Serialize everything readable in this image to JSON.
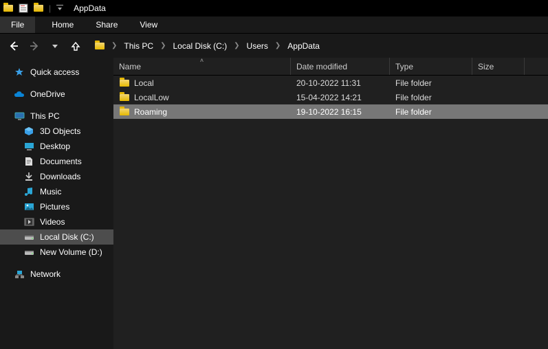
{
  "title": "AppData",
  "tabs": {
    "file": "File",
    "home": "Home",
    "share": "Share",
    "view": "View"
  },
  "breadcrumb": [
    "This PC",
    "Local Disk (C:)",
    "Users",
    "AppData"
  ],
  "sidebar": {
    "quick": "Quick access",
    "onedrive": "OneDrive",
    "thispc": "This PC",
    "children": [
      "3D Objects",
      "Desktop",
      "Documents",
      "Downloads",
      "Music",
      "Pictures",
      "Videos",
      "Local Disk (C:)",
      "New Volume (D:)"
    ],
    "network": "Network"
  },
  "columns": {
    "name": "Name",
    "date": "Date modified",
    "type": "Type",
    "size": "Size"
  },
  "rows": [
    {
      "name": "Local",
      "date": "20-10-2022 11:31",
      "type": "File folder",
      "selected": false
    },
    {
      "name": "LocalLow",
      "date": "15-04-2022 14:21",
      "type": "File folder",
      "selected": false
    },
    {
      "name": "Roaming",
      "date": "19-10-2022 16:15",
      "type": "File folder",
      "selected": true
    }
  ]
}
